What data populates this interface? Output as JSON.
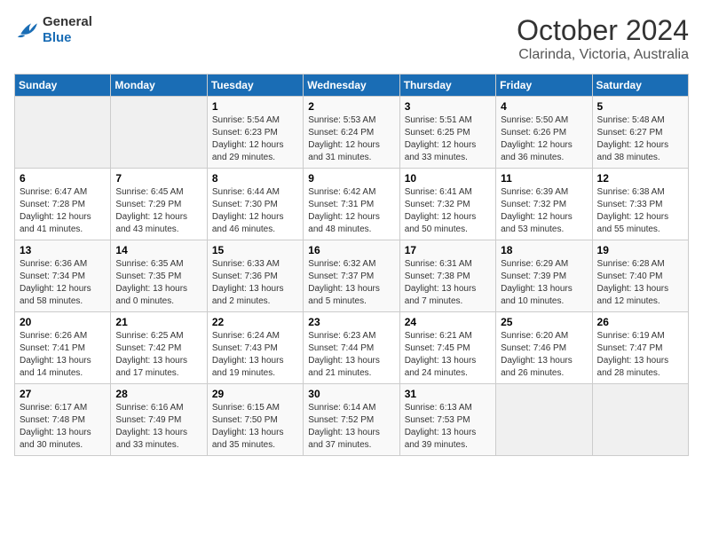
{
  "header": {
    "logo_general": "General",
    "logo_blue": "Blue",
    "month": "October 2024",
    "location": "Clarinda, Victoria, Australia"
  },
  "weekdays": [
    "Sunday",
    "Monday",
    "Tuesday",
    "Wednesday",
    "Thursday",
    "Friday",
    "Saturday"
  ],
  "weeks": [
    [
      {
        "day": "",
        "sunrise": "",
        "sunset": "",
        "daylight": ""
      },
      {
        "day": "",
        "sunrise": "",
        "sunset": "",
        "daylight": ""
      },
      {
        "day": "1",
        "sunrise": "Sunrise: 5:54 AM",
        "sunset": "Sunset: 6:23 PM",
        "daylight": "Daylight: 12 hours and 29 minutes."
      },
      {
        "day": "2",
        "sunrise": "Sunrise: 5:53 AM",
        "sunset": "Sunset: 6:24 PM",
        "daylight": "Daylight: 12 hours and 31 minutes."
      },
      {
        "day": "3",
        "sunrise": "Sunrise: 5:51 AM",
        "sunset": "Sunset: 6:25 PM",
        "daylight": "Daylight: 12 hours and 33 minutes."
      },
      {
        "day": "4",
        "sunrise": "Sunrise: 5:50 AM",
        "sunset": "Sunset: 6:26 PM",
        "daylight": "Daylight: 12 hours and 36 minutes."
      },
      {
        "day": "5",
        "sunrise": "Sunrise: 5:48 AM",
        "sunset": "Sunset: 6:27 PM",
        "daylight": "Daylight: 12 hours and 38 minutes."
      }
    ],
    [
      {
        "day": "6",
        "sunrise": "Sunrise: 6:47 AM",
        "sunset": "Sunset: 7:28 PM",
        "daylight": "Daylight: 12 hours and 41 minutes."
      },
      {
        "day": "7",
        "sunrise": "Sunrise: 6:45 AM",
        "sunset": "Sunset: 7:29 PM",
        "daylight": "Daylight: 12 hours and 43 minutes."
      },
      {
        "day": "8",
        "sunrise": "Sunrise: 6:44 AM",
        "sunset": "Sunset: 7:30 PM",
        "daylight": "Daylight: 12 hours and 46 minutes."
      },
      {
        "day": "9",
        "sunrise": "Sunrise: 6:42 AM",
        "sunset": "Sunset: 7:31 PM",
        "daylight": "Daylight: 12 hours and 48 minutes."
      },
      {
        "day": "10",
        "sunrise": "Sunrise: 6:41 AM",
        "sunset": "Sunset: 7:32 PM",
        "daylight": "Daylight: 12 hours and 50 minutes."
      },
      {
        "day": "11",
        "sunrise": "Sunrise: 6:39 AM",
        "sunset": "Sunset: 7:32 PM",
        "daylight": "Daylight: 12 hours and 53 minutes."
      },
      {
        "day": "12",
        "sunrise": "Sunrise: 6:38 AM",
        "sunset": "Sunset: 7:33 PM",
        "daylight": "Daylight: 12 hours and 55 minutes."
      }
    ],
    [
      {
        "day": "13",
        "sunrise": "Sunrise: 6:36 AM",
        "sunset": "Sunset: 7:34 PM",
        "daylight": "Daylight: 12 hours and 58 minutes."
      },
      {
        "day": "14",
        "sunrise": "Sunrise: 6:35 AM",
        "sunset": "Sunset: 7:35 PM",
        "daylight": "Daylight: 13 hours and 0 minutes."
      },
      {
        "day": "15",
        "sunrise": "Sunrise: 6:33 AM",
        "sunset": "Sunset: 7:36 PM",
        "daylight": "Daylight: 13 hours and 2 minutes."
      },
      {
        "day": "16",
        "sunrise": "Sunrise: 6:32 AM",
        "sunset": "Sunset: 7:37 PM",
        "daylight": "Daylight: 13 hours and 5 minutes."
      },
      {
        "day": "17",
        "sunrise": "Sunrise: 6:31 AM",
        "sunset": "Sunset: 7:38 PM",
        "daylight": "Daylight: 13 hours and 7 minutes."
      },
      {
        "day": "18",
        "sunrise": "Sunrise: 6:29 AM",
        "sunset": "Sunset: 7:39 PM",
        "daylight": "Daylight: 13 hours and 10 minutes."
      },
      {
        "day": "19",
        "sunrise": "Sunrise: 6:28 AM",
        "sunset": "Sunset: 7:40 PM",
        "daylight": "Daylight: 13 hours and 12 minutes."
      }
    ],
    [
      {
        "day": "20",
        "sunrise": "Sunrise: 6:26 AM",
        "sunset": "Sunset: 7:41 PM",
        "daylight": "Daylight: 13 hours and 14 minutes."
      },
      {
        "day": "21",
        "sunrise": "Sunrise: 6:25 AM",
        "sunset": "Sunset: 7:42 PM",
        "daylight": "Daylight: 13 hours and 17 minutes."
      },
      {
        "day": "22",
        "sunrise": "Sunrise: 6:24 AM",
        "sunset": "Sunset: 7:43 PM",
        "daylight": "Daylight: 13 hours and 19 minutes."
      },
      {
        "day": "23",
        "sunrise": "Sunrise: 6:23 AM",
        "sunset": "Sunset: 7:44 PM",
        "daylight": "Daylight: 13 hours and 21 minutes."
      },
      {
        "day": "24",
        "sunrise": "Sunrise: 6:21 AM",
        "sunset": "Sunset: 7:45 PM",
        "daylight": "Daylight: 13 hours and 24 minutes."
      },
      {
        "day": "25",
        "sunrise": "Sunrise: 6:20 AM",
        "sunset": "Sunset: 7:46 PM",
        "daylight": "Daylight: 13 hours and 26 minutes."
      },
      {
        "day": "26",
        "sunrise": "Sunrise: 6:19 AM",
        "sunset": "Sunset: 7:47 PM",
        "daylight": "Daylight: 13 hours and 28 minutes."
      }
    ],
    [
      {
        "day": "27",
        "sunrise": "Sunrise: 6:17 AM",
        "sunset": "Sunset: 7:48 PM",
        "daylight": "Daylight: 13 hours and 30 minutes."
      },
      {
        "day": "28",
        "sunrise": "Sunrise: 6:16 AM",
        "sunset": "Sunset: 7:49 PM",
        "daylight": "Daylight: 13 hours and 33 minutes."
      },
      {
        "day": "29",
        "sunrise": "Sunrise: 6:15 AM",
        "sunset": "Sunset: 7:50 PM",
        "daylight": "Daylight: 13 hours and 35 minutes."
      },
      {
        "day": "30",
        "sunrise": "Sunrise: 6:14 AM",
        "sunset": "Sunset: 7:52 PM",
        "daylight": "Daylight: 13 hours and 37 minutes."
      },
      {
        "day": "31",
        "sunrise": "Sunrise: 6:13 AM",
        "sunset": "Sunset: 7:53 PM",
        "daylight": "Daylight: 13 hours and 39 minutes."
      },
      {
        "day": "",
        "sunrise": "",
        "sunset": "",
        "daylight": ""
      },
      {
        "day": "",
        "sunrise": "",
        "sunset": "",
        "daylight": ""
      }
    ]
  ]
}
